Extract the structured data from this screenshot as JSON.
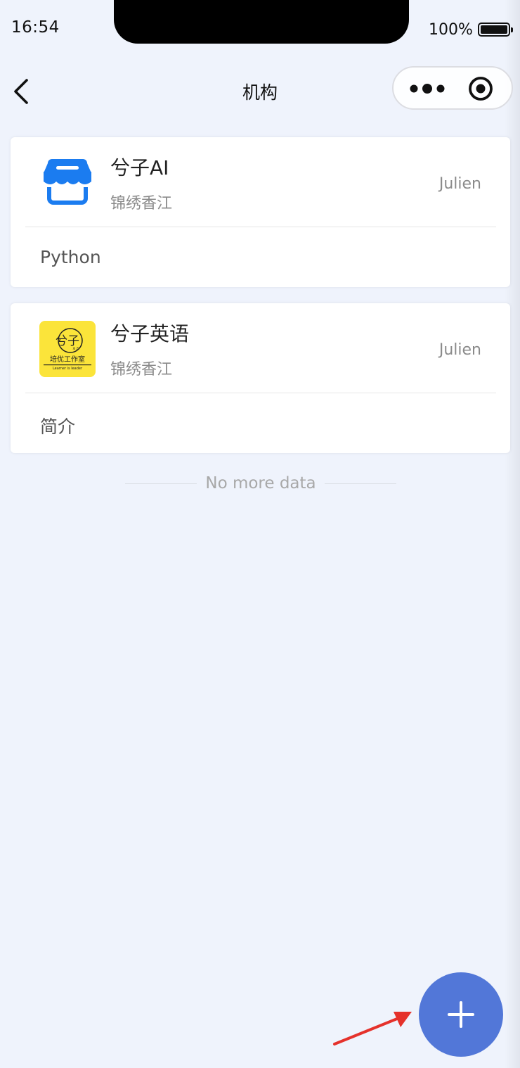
{
  "status_bar": {
    "time": "16:54",
    "battery_percent": "100%",
    "battery_level": 1.0
  },
  "nav": {
    "title": "机构",
    "back_icon": "chevron-left-icon",
    "more_icon": "more-dots-icon",
    "close_icon": "target-close-icon"
  },
  "organizations": [
    {
      "name": "兮子AI",
      "subtitle": "锦绣香江",
      "owner": "Julien",
      "description": "Python",
      "logo_icon": "store-icon"
    },
    {
      "name": "兮子英语",
      "subtitle": "锦绣香江",
      "owner": "Julien",
      "description": "简介",
      "logo_icon": "xizi-logo"
    }
  ],
  "logo_text": {
    "xizi_main": "兮子",
    "xizi_small": "XI ZI",
    "xizi_line": "培优工作室",
    "xizi_slogan": "Learner is leader"
  },
  "list_footer": "No more data",
  "fab": {
    "icon": "plus-icon"
  },
  "colors": {
    "background": "#eff3fc",
    "fab": "#5277d8",
    "store_icon": "#1b7cf0",
    "xizi_logo_bg": "#fbe43a",
    "arrow": "#e5312b"
  }
}
